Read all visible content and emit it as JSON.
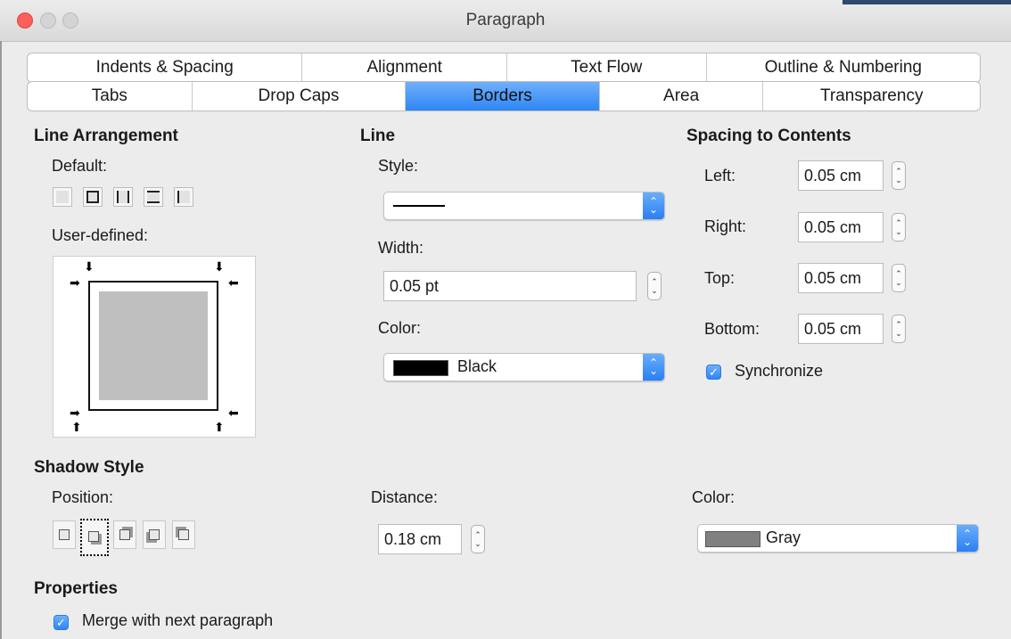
{
  "window": {
    "title": "Paragraph"
  },
  "tabs": {
    "row1": [
      "Indents & Spacing",
      "Alignment",
      "Text Flow",
      "Outline & Numbering"
    ],
    "row2": [
      "Tabs",
      "Drop Caps",
      "Borders",
      "Area",
      "Transparency"
    ],
    "active": "Borders"
  },
  "line_arrangement": {
    "heading": "Line Arrangement",
    "default_label": "Default:",
    "user_defined_label": "User-defined:"
  },
  "line": {
    "heading": "Line",
    "style_label": "Style:",
    "width_label": "Width:",
    "width_value": "0.05 pt",
    "color_label": "Color:",
    "color_value": "Black",
    "color_swatch": "#000000"
  },
  "spacing": {
    "heading": "Spacing to Contents",
    "left_label": "Left:",
    "left_value": "0.05 cm",
    "right_label": "Right:",
    "right_value": "0.05 cm",
    "top_label": "Top:",
    "top_value": "0.05 cm",
    "bottom_label": "Bottom:",
    "bottom_value": "0.05 cm",
    "synchronize_label": "Synchronize",
    "synchronize_checked": true
  },
  "shadow": {
    "heading": "Shadow Style",
    "position_label": "Position:",
    "distance_label": "Distance:",
    "distance_value": "0.18 cm",
    "color_label": "Color:",
    "color_value": "Gray",
    "color_swatch": "#808080"
  },
  "properties": {
    "heading": "Properties",
    "merge_label": "Merge with next paragraph",
    "merge_checked": true
  }
}
